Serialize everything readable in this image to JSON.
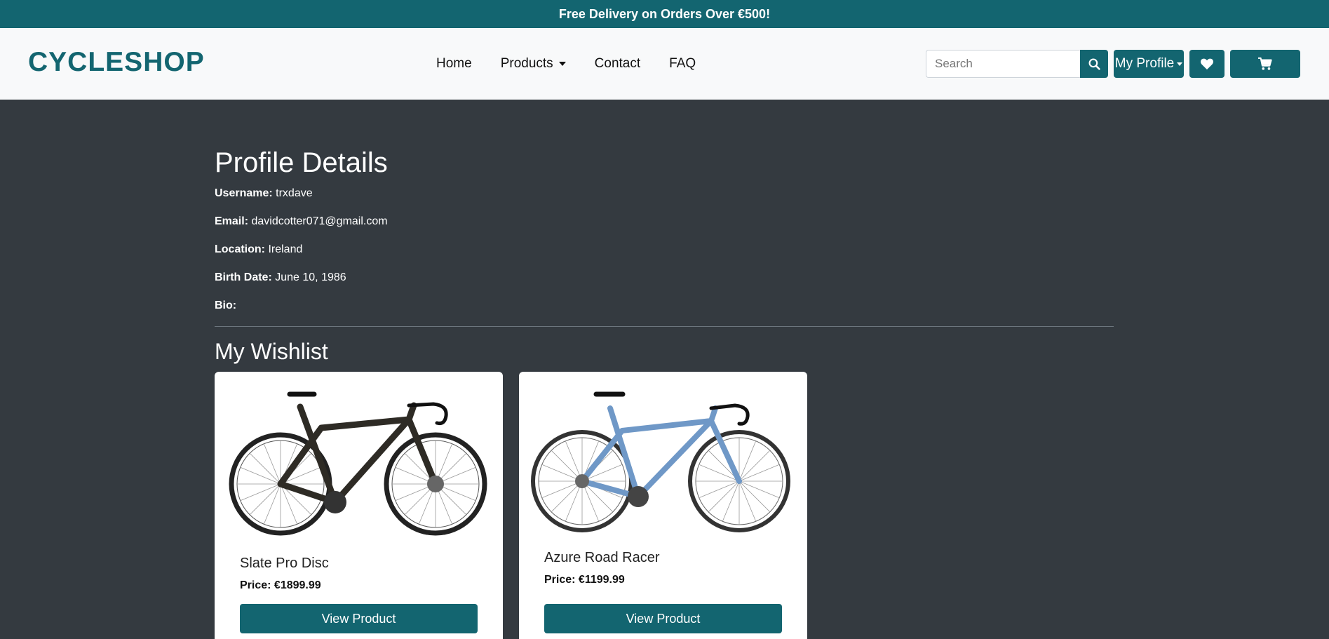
{
  "promo": {
    "text": "Free Delivery on Orders Over €500!"
  },
  "nav": {
    "brand": "CYCLESHOP",
    "links": [
      {
        "label": "Home"
      },
      {
        "label": "Products"
      },
      {
        "label": "Contact"
      },
      {
        "label": "FAQ"
      }
    ],
    "search": {
      "placeholder": "Search"
    },
    "profile_label": "My Profile",
    "icons": {
      "search": "search-icon",
      "wishlist": "heart-icon",
      "cart": "cart-icon"
    }
  },
  "profile": {
    "title": "Profile Details",
    "fields": [
      {
        "label": "Username:",
        "value": "trxdave"
      },
      {
        "label": "Email:",
        "value": "davidcotter071@gmail.com"
      },
      {
        "label": "Location:",
        "value": "Ireland"
      },
      {
        "label": "Birth Date:",
        "value": "June 10, 1986"
      },
      {
        "label": "Bio:",
        "value": ""
      }
    ]
  },
  "wishlist": {
    "title": "My Wishlist",
    "items": [
      {
        "name": "Slate Pro Disc",
        "price": "Price: €1899.99",
        "button": "View Product",
        "frame_color": "#2e2b25"
      },
      {
        "name": "Azure Road Racer",
        "price": "Price: €1199.99",
        "button": "View Product",
        "frame_color": "#6f98c7"
      }
    ]
  },
  "colors": {
    "accent": "#136570",
    "background": "#343a40",
    "navbar": "#f8f9fa"
  }
}
